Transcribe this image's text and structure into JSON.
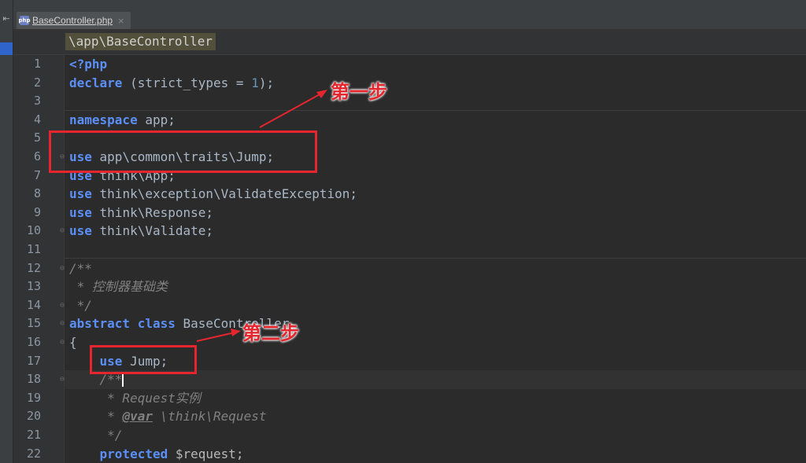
{
  "tab": {
    "file_name": "BaseController.php",
    "close": "×",
    "icon": "php-file-icon"
  },
  "breadcrumb": "\\app\\BaseController",
  "code_lines": [
    {
      "n": "1"
    },
    {
      "n": "2"
    },
    {
      "n": "3"
    },
    {
      "n": "4"
    },
    {
      "n": "5"
    },
    {
      "n": "6"
    },
    {
      "n": "7"
    },
    {
      "n": "8"
    },
    {
      "n": "9"
    },
    {
      "n": "10"
    },
    {
      "n": "11"
    },
    {
      "n": "12"
    },
    {
      "n": "13"
    },
    {
      "n": "14"
    },
    {
      "n": "15"
    },
    {
      "n": "16"
    },
    {
      "n": "17"
    },
    {
      "n": "18"
    },
    {
      "n": "19"
    },
    {
      "n": "20"
    },
    {
      "n": "21"
    },
    {
      "n": "22"
    }
  ],
  "code": {
    "l1": "<?php",
    "l2_kw": "declare",
    "l2_rest": " (strict_types = ",
    "l2_num": "1",
    "l2_end": ");",
    "l4_kw": "namespace",
    "l4_rest": " app;",
    "l6_kw": "use",
    "l6_rest": " app\\common\\traits\\Jump;",
    "l7_kw": "use",
    "l7_rest": " think\\App;",
    "l8_kw": "use",
    "l8_rest": " think\\exception\\ValidateException;",
    "l9_kw": "use",
    "l9_rest": " think\\Response;",
    "l10_kw": "use",
    "l10_rest": " think\\Validate;",
    "l12": "/**",
    "l13": " * 控制器基础类",
    "l14": " */",
    "l15_kw1": "abstract",
    "l15_kw2": "class",
    "l15_rest": " BaseController",
    "l16": "{",
    "l17_kw": "use",
    "l17_rest": " Jump;",
    "l18": "/**",
    "l19": " * Request实例",
    "l20_star": " * ",
    "l20_tag": "@var",
    "l20_rest": " \\think\\Request",
    "l21": " */",
    "l22_kw": "protected",
    "l22_rest": " $request;"
  },
  "annotations": {
    "step1": "第一步",
    "step2": "第二步",
    "color": "#e5262e"
  },
  "colors": {
    "keyword": "#5b8ff5",
    "number": "#6897bb",
    "comment": "#808080",
    "background": "#2b2b2b"
  }
}
